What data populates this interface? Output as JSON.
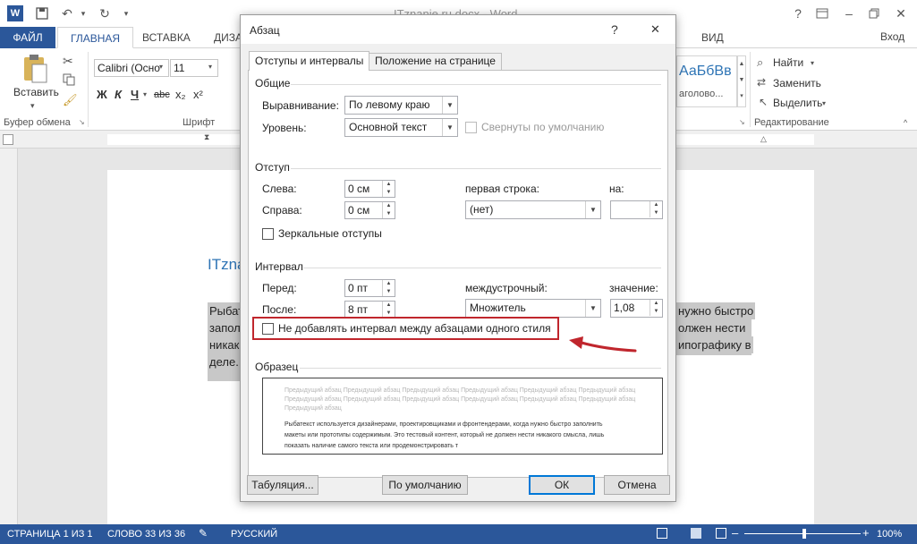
{
  "window": {
    "doc_title": "ITznanie.ru.docx - Word",
    "help": "?",
    "login": "Вход"
  },
  "tabs": [
    "ФАЙЛ",
    "ГЛАВНАЯ",
    "ВСТАВКА",
    "ДИЗА",
    "ВИД"
  ],
  "ribbon": {
    "paste": "Вставить",
    "clipboard_group": "Буфер обмена",
    "font_name": "Calibri (Осно",
    "font_size": "11",
    "font_group": "Шрифт",
    "styles_preview": "АаБбВв",
    "styles_caption": "аголово...",
    "find": "Найти",
    "replace": "Заменить",
    "select": "Выделить",
    "edit_group": "Редактирование"
  },
  "document": {
    "heading_fragment": "ITzna",
    "left_lines": [
      "Рыбат",
      "запол",
      "никак",
      "деле."
    ],
    "right_lines": [
      "нужно быстро",
      "олжен нести",
      "ипографику в"
    ]
  },
  "statusbar": {
    "page": "СТРАНИЦА 1 ИЗ 1",
    "words": "СЛОВО 33 ИЗ 36",
    "lang": "РУССКИЙ",
    "zoom": "100%"
  },
  "dialog": {
    "title": "Абзац",
    "help": "?",
    "close": "✕",
    "tab_indents": "Отступы и интервалы",
    "tab_position": "Положение на странице",
    "section_general": "Общие",
    "alignment_label": "Выравнивание:",
    "alignment_value": "По левому краю",
    "level_label": "Уровень:",
    "level_value": "Основной текст",
    "collapsed_label": "Свернуты по умолчанию",
    "section_indent": "Отступ",
    "left_label": "Слева:",
    "left_value": "0 см",
    "right_label": "Справа:",
    "right_value": "0 см",
    "first_line_label": "первая строка:",
    "first_line_value": "(нет)",
    "by_label": "на:",
    "by_value": "",
    "mirror_label": "Зеркальные отступы",
    "section_spacing": "Интервал",
    "before_label": "Перед:",
    "before_value": "0 пт",
    "after_label": "После:",
    "after_value": "8 пт",
    "line_spacing_label": "междустрочный:",
    "line_spacing_value": "Множитель",
    "at_label": "значение:",
    "at_value": "1,08",
    "dont_add_label": "Не добавлять интервал между абзацами одного стиля",
    "section_preview": "Образец",
    "preview_prev": [
      "Предыдущий абзац Предыдущий абзац Предыдущий абзац Предыдущий абзац Предыдущий абзац Предыдущий абзац",
      "Предыдущий абзац Предыдущий абзац Предыдущий абзац Предыдущий абзац Предыдущий абзац Предыдущий абзац",
      "Предыдущий абзац"
    ],
    "preview_text": [
      "Рыбатекст используется дизайнерами, проектировщиками и фронтендерами, когда нужно быстро заполнить",
      "макеты или прототипы содержимым. Это тестовый контент, который не должен нести никакого смысла, лишь",
      "показать наличие самого текста или продемонстрировать т"
    ],
    "btn_tabs": "Табуляция...",
    "btn_default": "По умолчанию",
    "btn_ok": "ОК",
    "btn_cancel": "Отмена"
  },
  "colors": {
    "accent": "#2b579a",
    "annotation": "#c0262d"
  }
}
